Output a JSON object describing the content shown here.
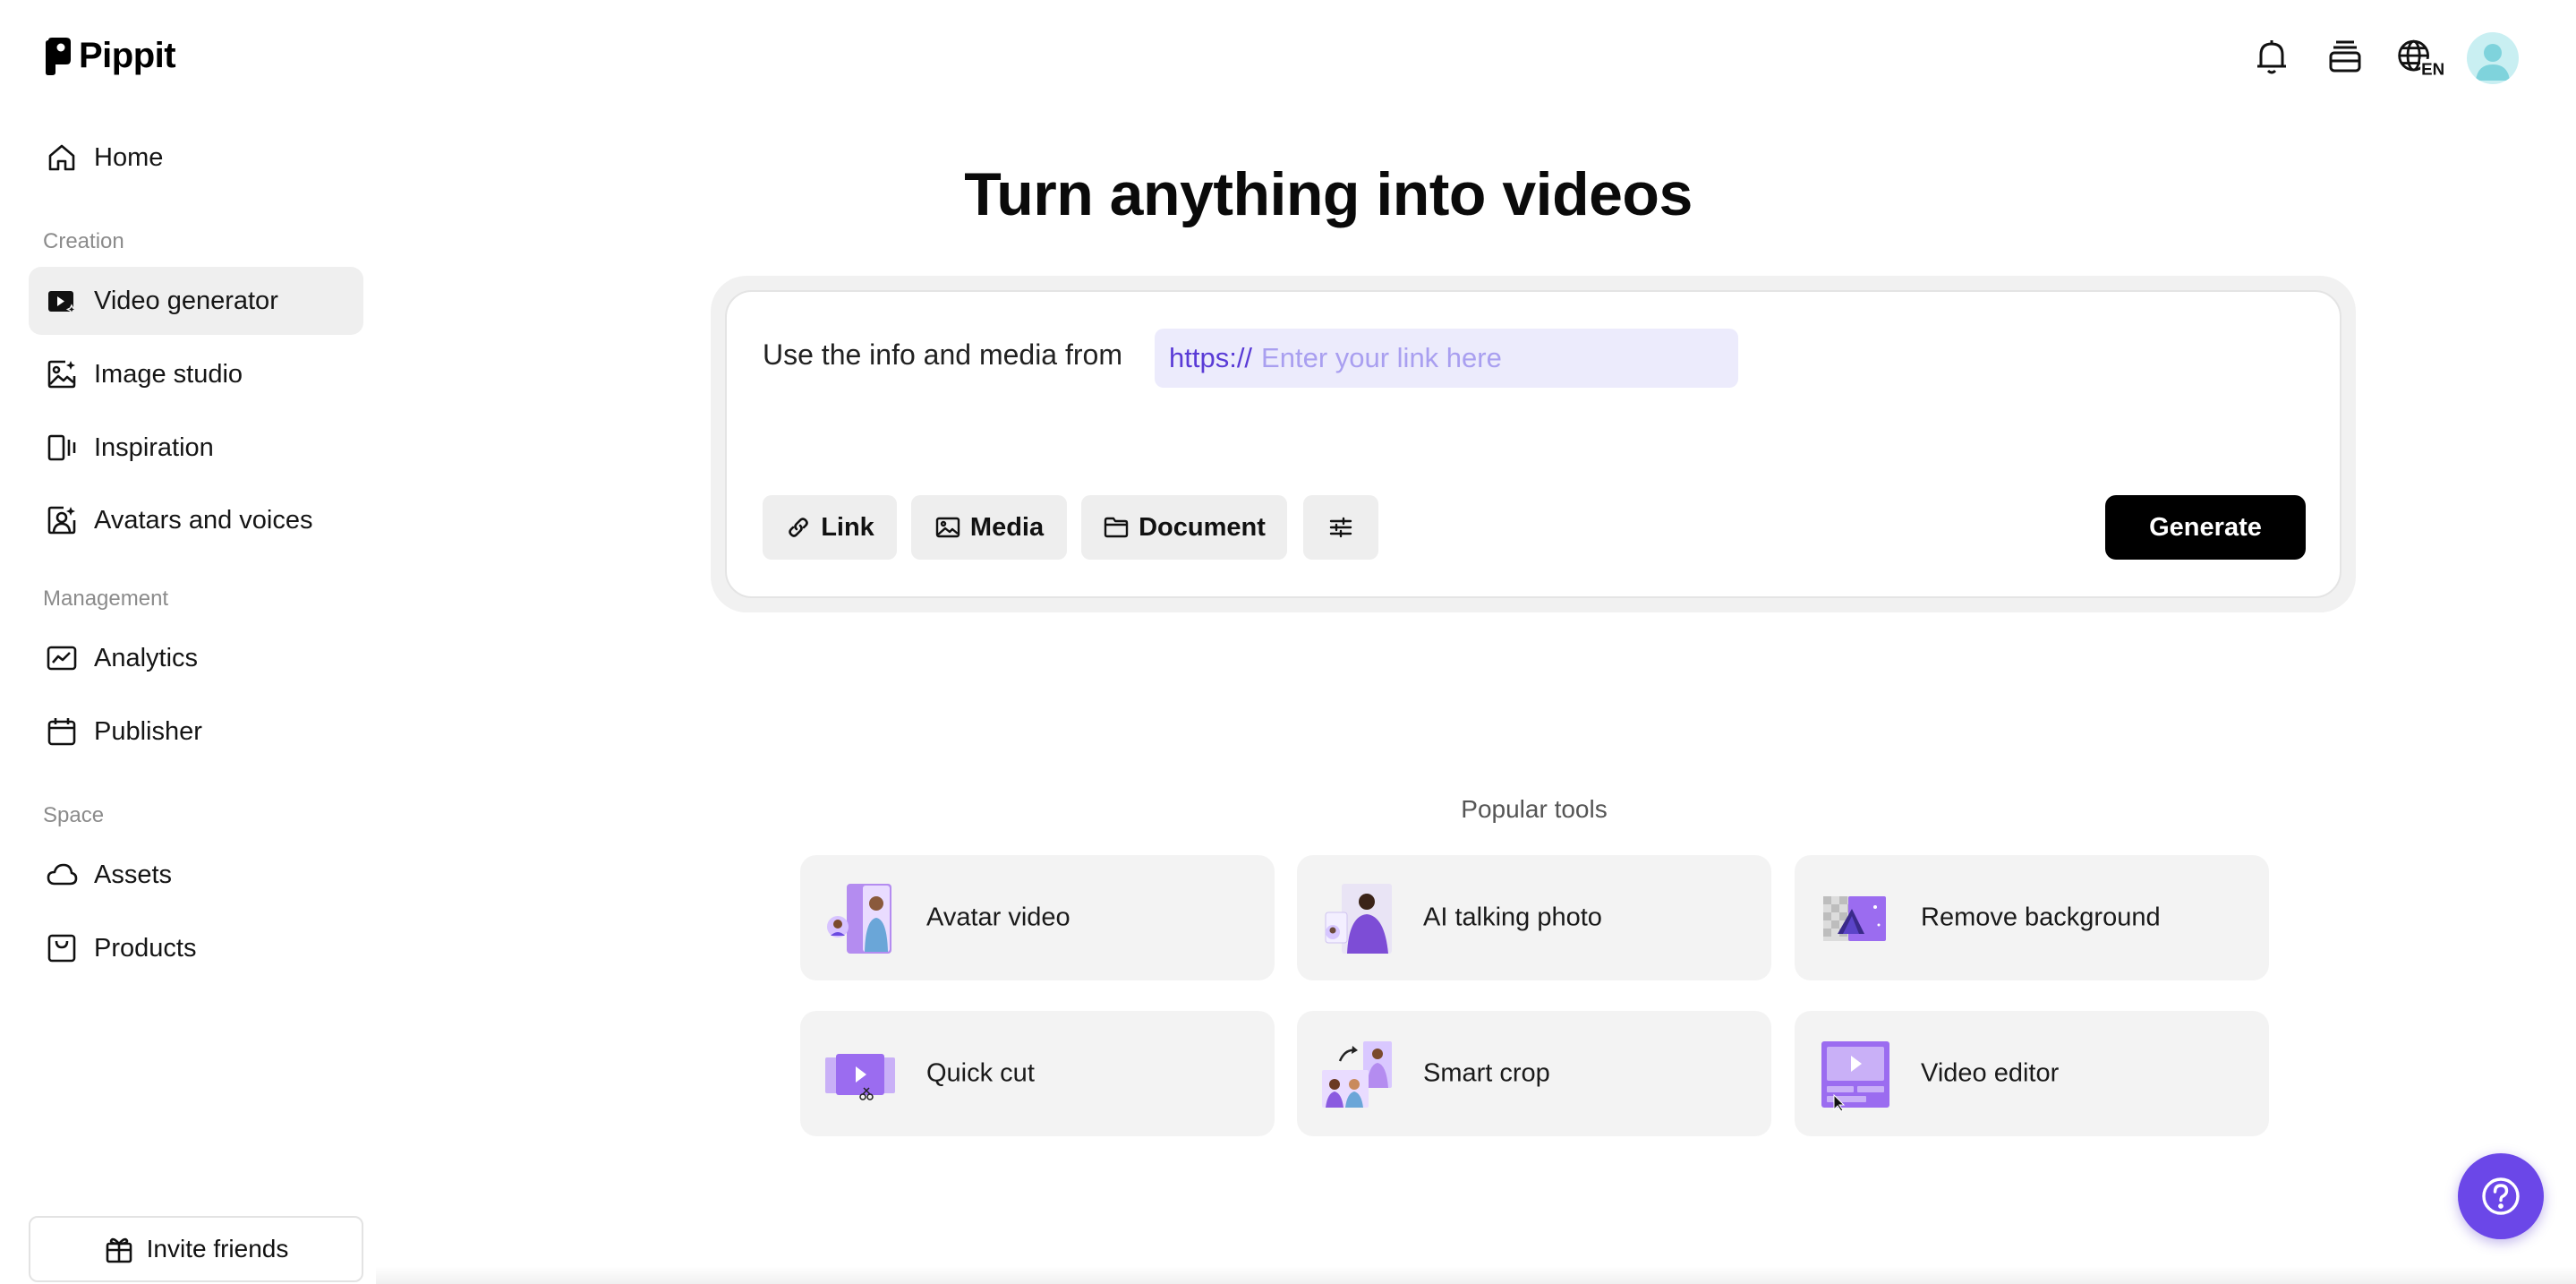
{
  "brand": {
    "name": "Pippit"
  },
  "sidebar": {
    "home": {
      "label": "Home",
      "icon": "home-icon"
    },
    "sections": {
      "creation": "Creation",
      "management": "Management",
      "space": "Space"
    },
    "creation_items": [
      {
        "label": "Video generator",
        "icon": "video-generator-icon",
        "active": true
      },
      {
        "label": "Image studio",
        "icon": "image-studio-icon"
      },
      {
        "label": "Inspiration",
        "icon": "inspiration-icon"
      },
      {
        "label": "Avatars and voices",
        "icon": "avatar-voice-icon"
      }
    ],
    "management_items": [
      {
        "label": "Analytics",
        "icon": "analytics-icon"
      },
      {
        "label": "Publisher",
        "icon": "calendar-icon"
      }
    ],
    "space_items": [
      {
        "label": "Assets",
        "icon": "cloud-icon"
      },
      {
        "label": "Products",
        "icon": "product-icon"
      }
    ],
    "invite": {
      "label": "Invite friends",
      "icon": "gift-icon"
    }
  },
  "header": {
    "icons": [
      "bell-icon",
      "credits-icon",
      "language-icon"
    ],
    "language": "EN"
  },
  "main": {
    "headline": "Turn anything into videos",
    "prompt": {
      "lead_text": "Use the info and media from",
      "link_prefix": "https://",
      "link_placeholder": "Enter your link here",
      "buttons": [
        {
          "label": "Link",
          "icon": "link-icon"
        },
        {
          "label": "Media",
          "icon": "image-icon"
        },
        {
          "label": "Document",
          "icon": "folder-icon"
        },
        {
          "label": "",
          "icon": "settings-sliders-icon"
        }
      ],
      "generate_label": "Generate"
    },
    "popular": {
      "title": "Popular tools",
      "tools": [
        {
          "label": "Avatar video"
        },
        {
          "label": "AI talking photo"
        },
        {
          "label": "Remove background"
        },
        {
          "label": "Quick cut"
        },
        {
          "label": "Smart crop"
        },
        {
          "label": "Video editor"
        }
      ]
    }
  },
  "colors": {
    "accent": "#6b47e8",
    "link_field_bg": "#ecebfc",
    "link_prefix": "#5a3bd6",
    "active_nav_bg": "#efefef"
  }
}
